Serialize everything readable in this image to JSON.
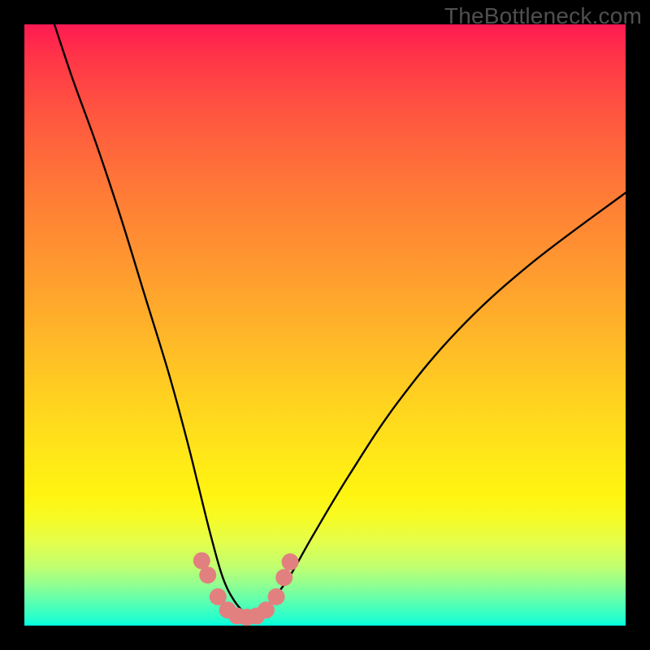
{
  "watermark": "TheBottleneck.com",
  "chart_data": {
    "type": "line",
    "title": "",
    "xlabel": "",
    "ylabel": "",
    "xlim": [
      0,
      100
    ],
    "ylim": [
      0,
      100
    ],
    "grid": false,
    "legend": false,
    "series": [
      {
        "name": "bottleneck-curve",
        "x": [
          5,
          8,
          12,
          16,
          20,
          24,
          27,
          29,
          31,
          33,
          35,
          37,
          39,
          41,
          44,
          48,
          54,
          62,
          72,
          84,
          100
        ],
        "y": [
          100,
          91,
          80,
          68,
          55,
          42,
          31,
          23,
          15,
          8,
          4,
          2,
          2,
          4,
          8,
          15,
          25,
          37,
          49,
          60,
          72
        ]
      },
      {
        "name": "highlight-dots",
        "x": [
          29.5,
          30.5,
          32.2,
          33.8,
          35.4,
          37.0,
          38.6,
          40.2,
          41.9,
          43.2,
          44.2
        ],
        "y": [
          10.8,
          8.4,
          4.8,
          2.6,
          1.6,
          1.4,
          1.6,
          2.6,
          4.8,
          8.0,
          10.6
        ]
      }
    ],
    "colors": {
      "curve": "#000000",
      "dots": "#e28080",
      "gradient_top": "#ff1a52",
      "gradient_bottom": "#00ffde"
    }
  }
}
